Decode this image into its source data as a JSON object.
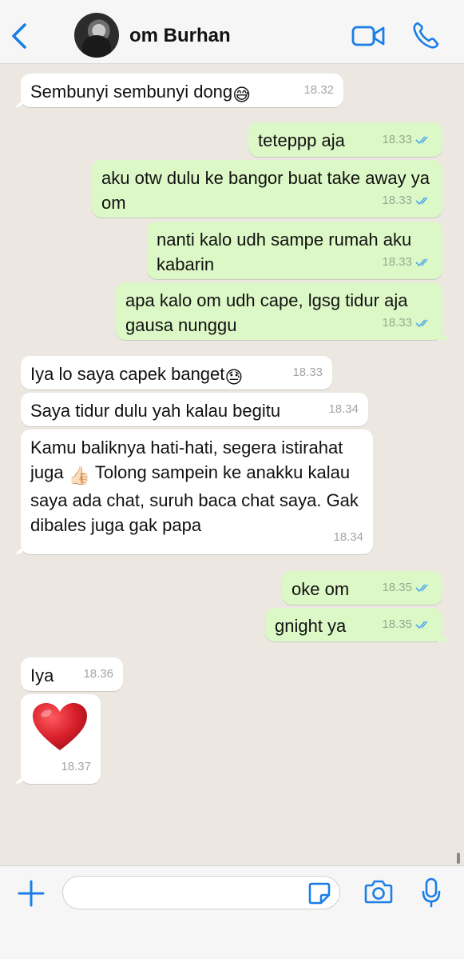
{
  "header": {
    "contact_name": "om Burhan",
    "accent_color": "#1a7ee6"
  },
  "messages": [
    {
      "dir": "in",
      "text": "Sembunyi sembunyi dong",
      "emoji": "😅",
      "time": "18.32"
    },
    {
      "dir": "out",
      "text": "teteppp aja",
      "time": "18.33",
      "status": "read"
    },
    {
      "dir": "out",
      "text": "aku otw dulu ke bangor buat take away ya om",
      "time": "18.33",
      "status": "read"
    },
    {
      "dir": "out",
      "text": "nanti kalo udh sampe rumah aku kabarin",
      "time": "18.33",
      "status": "read"
    },
    {
      "dir": "out",
      "text": "apa kalo om udh cape, lgsg tidur aja gausa nunggu",
      "time": "18.33",
      "status": "read"
    },
    {
      "dir": "in",
      "text": "Iya lo saya capek banget",
      "emoji": "😓",
      "time": "18.33"
    },
    {
      "dir": "in",
      "text": "Saya tidur dulu yah kalau begitu",
      "time": "18.34"
    },
    {
      "dir": "in",
      "text_a": "Kamu baliknya hati-hati, segera istirahat juga",
      "emoji": "👍🏻",
      "text_b": "Tolong sampein ke anakku kalau saya ada chat, suruh baca chat saya. Gak dibales juga gak papa",
      "time": "18.34"
    },
    {
      "dir": "out",
      "text": "oke om",
      "time": "18.35",
      "status": "read"
    },
    {
      "dir": "out",
      "text": "gnight ya",
      "time": "18.35",
      "status": "read"
    },
    {
      "dir": "in",
      "text": "Iya",
      "time": "18.36"
    },
    {
      "dir": "in",
      "emoji": "heart",
      "time": "18.37"
    }
  ],
  "composer": {
    "value": "",
    "placeholder": ""
  },
  "colors": {
    "chat_bg": "#ece8e1",
    "incoming": "#ffffff",
    "outgoing": "#dcf8c6",
    "read_ticks": "#4fa9e7",
    "heart": "#d71f2a"
  }
}
